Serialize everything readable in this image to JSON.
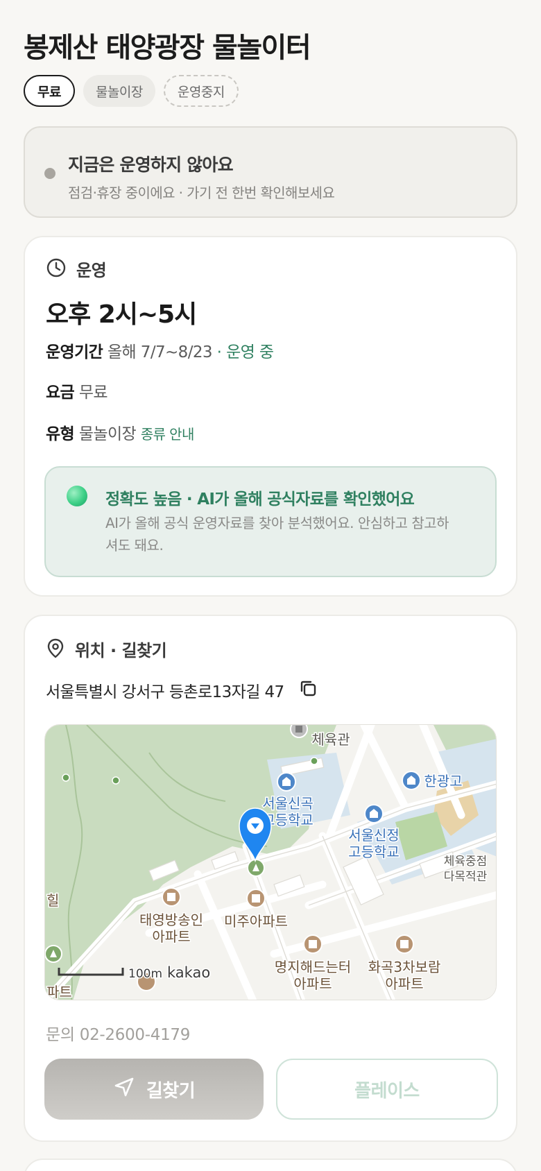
{
  "header": {
    "title": "봉제산 태양광장 물놀이터"
  },
  "chips": [
    {
      "label": "무료"
    },
    {
      "label": "물놀이장"
    },
    {
      "label": "운영중지"
    }
  ],
  "status": {
    "title": "지금은 운영하지 않아요",
    "subtitle": "점검·휴장 중이에요 · 가기 전 한번 확인해보세요"
  },
  "hours": {
    "section_label": "운영",
    "time_text": "오후 2시~5시",
    "period_label": "운영기간",
    "period_value": "올해 7/7~8/23",
    "period_status": "· 운영 중",
    "fee_label": "요금",
    "fee_value": "무료",
    "type_label": "유형",
    "type_value": "물놀이장",
    "type_link": "종류 안내"
  },
  "ai_notice": {
    "title": "정확도 높음 · AI가 올해 공식자료를 확인했어요",
    "body": "AI가 올해 공식 운영자료를 찾아 분석했어요. 안심하고 참고하셔도 돼요."
  },
  "location": {
    "section_label": "위치 · 길찾기",
    "address": "서울특별시 강서구 등촌로13자길 47",
    "phone": "문의 02-2600-4179",
    "map": {
      "labels": {
        "gym": "체육관",
        "school1_line1": "서울신곡",
        "school1_line2": "고등학교",
        "school2_line1": "서울신정",
        "school2_line2": "고등학교",
        "hanggwang": "한광고",
        "sports_line1": "체육중점",
        "sports_line2": "다목적관",
        "apt1_line1": "태영방송인",
        "apt1_line2": "아파트",
        "apt2": "미주아파트",
        "apt3_line1": "명지해드는터",
        "apt3_line2": "아파트",
        "apt4_line1": "화곡3차보람",
        "apt4_line2": "아파트",
        "edge_left": "힐",
        "edge_bottom": "파트",
        "scale": "100m",
        "brand": "kakao"
      }
    }
  },
  "actions": {
    "route_label": "길찾기",
    "place_label": "플레이스"
  },
  "colors": {
    "accent_green": "#2f8060",
    "map_pin": "#1f86f0",
    "park_green": "#c8dcbc"
  }
}
